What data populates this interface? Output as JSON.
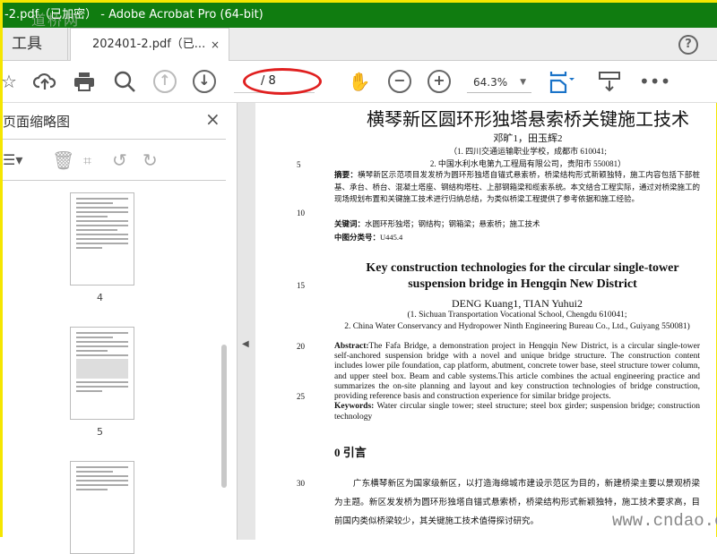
{
  "window": {
    "title": "-2.pdf（已加密） - Adobe Acrobat Pro (64-bit)",
    "watermark_top": "道桥网",
    "watermark_bottom": "www.cndao.com"
  },
  "tabs": {
    "tools": "工具",
    "document": "202401-2.pdf（已...",
    "close": "×",
    "help": "?"
  },
  "toolbar": {
    "page_label": "/ 8",
    "zoom": "64.3%"
  },
  "left_panel": {
    "title": "页面缩略图",
    "close": "×",
    "thumbnails": [
      {
        "label": "4"
      },
      {
        "label": "5"
      }
    ]
  },
  "page": {
    "line_numbers": [
      "5",
      "10",
      "15",
      "20",
      "25",
      "30"
    ],
    "cn_title": "横琴新区圆环形独塔悬索桥关键施工技术",
    "cn_authors": "邓旷1，田玉辉2",
    "cn_aff1": "（1. 四川交通运输职业学校，成都市 610041;",
    "cn_aff2": "2. 中国水利水电第九工程局有限公司，贵阳市 550081）",
    "cn_abstract_label": "摘要：",
    "cn_abstract": "横琴新区示范项目发发桥为圆环形独塔自锚式悬索桥，桥梁结构形式新颖独特，施工内容包括下部桩基、承台、桥台、混凝土塔座、钢结构塔柱、上部钢箱梁和缆索系统。本文结合工程实际，通过对桥梁施工的现场规划布置和关键施工技术进行归纳总结，为类似桥梁工程提供了参考依据和施工经验。",
    "cn_keywords_label": "关键词：",
    "cn_keywords": "水圆环形独塔；钢结构；钢箱梁；悬索桥；施工技术",
    "cn_class_label": "中图分类号：",
    "cn_class": "U445.4",
    "en_title": "Key construction technologies for the circular single-tower suspension bridge in Hengqin New District",
    "en_authors": "DENG Kuang1, TIAN Yuhui2",
    "en_aff1": "(1. Sichuan Transportation Vocational School, Chengdu 610041;",
    "en_aff2": "2. China Water Conservancy and Hydropower Ninth Engineering Bureau Co., Ltd., Guiyang 550081)",
    "en_abstract_label": "Abstract:",
    "en_abstract": "The Fafa Bridge, a demonstration project in Hengqin New District, is a circular single-tower self-anchored suspension bridge with a novel and unique bridge structure. The construction content includes lower pile foundation, cap platform, abutment, concrete tower base, steel structure tower column, and upper steel box. Beam and cable systems.This article combines the actual engineering practice and summarizes the on-site planning and layout and key construction technologies of bridge construction, providing reference basis and construction experience for similar bridge projects.",
    "en_keywords_label": "Keywords:",
    "en_keywords": "Water circular single tower; steel structure; steel box girder; suspension bridge; construction technology",
    "section_heading": "0   引言",
    "intro": "广东横琴新区为国家级新区，以打造海绵城市建设示范区为目的，新建桥梁主要以景观桥梁为主题。新区发发桥为圆环形独塔自锚式悬索桥，桥梁结构形式新颖独特，施工技术要求高，目前国内类似桥梁较少，其关键施工技术值得探讨研究。"
  }
}
